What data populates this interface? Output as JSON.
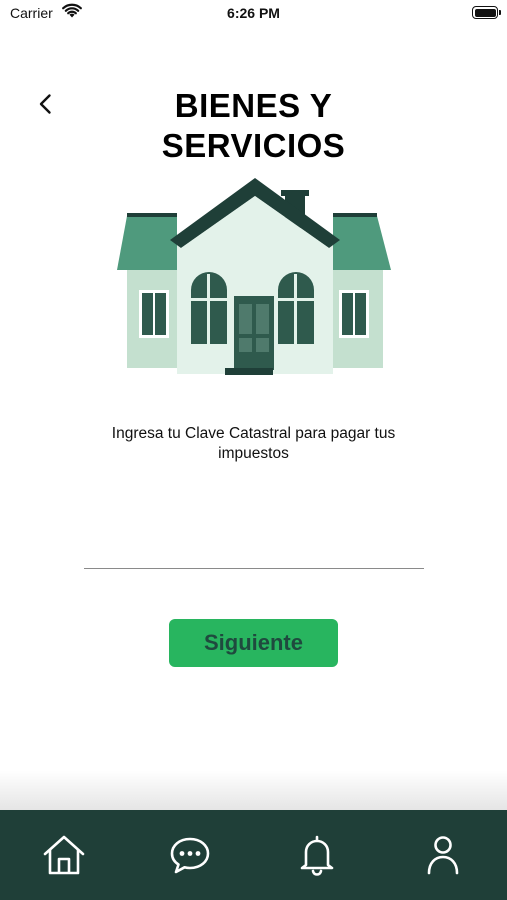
{
  "status_bar": {
    "carrier": "Carrier",
    "time": "6:26 PM"
  },
  "header": {
    "back_icon": "chevron-left-icon",
    "title": "BIENES Y SERVICIOS"
  },
  "illustration": {
    "icon": "house-illustration",
    "colors": {
      "roof_dark": "#1f3f38",
      "roof_light": "#4f9a7d",
      "wall_main": "#e3f2ea",
      "wall_side": "#c4e0cf",
      "windows": "#2f5a4d"
    }
  },
  "main": {
    "instruction": "Ingresa tu Clave Catastral para pagar tus impuestos",
    "input_value": "",
    "input_placeholder": "",
    "next_button_label": "Siguiente"
  },
  "bottom_nav": {
    "background": "#1f3f38",
    "items": [
      {
        "icon": "home-icon"
      },
      {
        "icon": "chat-bubble-icon"
      },
      {
        "icon": "bell-icon"
      },
      {
        "icon": "user-icon"
      }
    ]
  },
  "colors": {
    "accent": "#28b55f",
    "button_text": "#1f4a3e"
  }
}
